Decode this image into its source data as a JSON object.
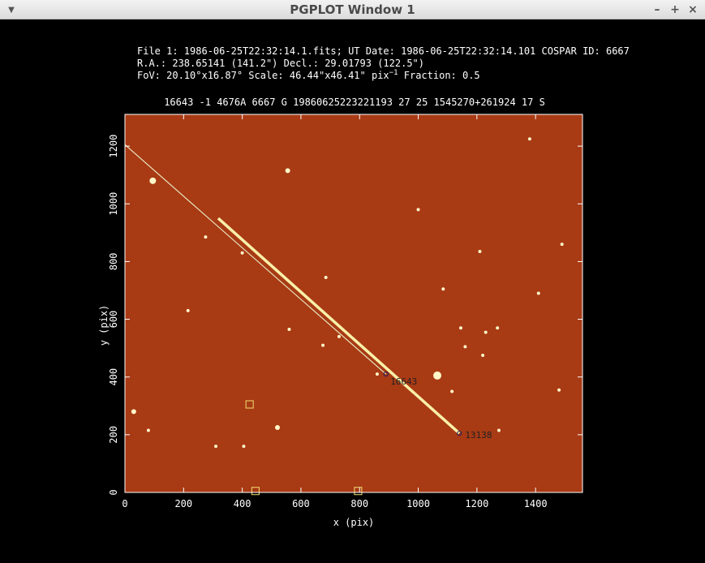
{
  "window": {
    "title": "PGPLOT Window 1",
    "menu_icon": "chevron-down-icon",
    "minimize_label": "–",
    "maximize_label": "+",
    "close_label": "×"
  },
  "header": {
    "line1": "File 1: 1986-06-25T22:32:14.1.fits; UT Date: 1986-06-25T22:32:14.101  COSPAR ID: 6667",
    "line2": "R.A.:  238.65141 (141.2\")  Decl.:   29.01793 (122.5\")",
    "line3_a": "FoV: 20.10°x16.87° Scale: 46.44\"x46.41\" pix",
    "line3_sup": "−1",
    "line3_b": " Fraction: 0.5",
    "line4": "16643 -1 4676A  6667 G 19860625223221193 27 25 1545270+261924 17 S"
  },
  "chart_data": {
    "type": "scatter",
    "xlabel": "x (pix)",
    "ylabel": "y (pix)",
    "xlim": [
      0,
      1560
    ],
    "ylim": [
      0,
      1310
    ],
    "x_ticks": [
      0,
      200,
      400,
      600,
      800,
      1000,
      1200,
      1400
    ],
    "y_ticks": [
      0,
      200,
      400,
      600,
      800,
      1000,
      1200
    ],
    "background_color": "#a83a14",
    "streaks": [
      {
        "label": "16643",
        "x1": 0,
        "y1": 1205,
        "x2": 890,
        "y2": 410,
        "color": "#e8e8c0"
      },
      {
        "label": "13138",
        "x1": 318,
        "y1": 950,
        "x2": 1140,
        "y2": 205,
        "color": "#f8f0a8"
      }
    ],
    "labels": [
      {
        "text": "16643",
        "x": 905,
        "y": 385
      },
      {
        "text": "13138",
        "x": 1160,
        "y": 200
      }
    ],
    "markers": [
      {
        "x": 425,
        "y": 305,
        "shape": "square"
      },
      {
        "x": 445,
        "y": 5,
        "shape": "square"
      },
      {
        "x": 795,
        "y": 5,
        "shape": "square"
      }
    ],
    "stars": [
      {
        "x": 95,
        "y": 1080,
        "r": 4
      },
      {
        "x": 555,
        "y": 1115,
        "r": 3
      },
      {
        "x": 275,
        "y": 885,
        "r": 2
      },
      {
        "x": 400,
        "y": 830,
        "r": 2
      },
      {
        "x": 1210,
        "y": 835,
        "r": 2
      },
      {
        "x": 1490,
        "y": 860,
        "r": 2
      },
      {
        "x": 685,
        "y": 745,
        "r": 2
      },
      {
        "x": 1000,
        "y": 980,
        "r": 2
      },
      {
        "x": 1410,
        "y": 690,
        "r": 2
      },
      {
        "x": 1085,
        "y": 705,
        "r": 2
      },
      {
        "x": 1270,
        "y": 570,
        "r": 2
      },
      {
        "x": 1230,
        "y": 555,
        "r": 2
      },
      {
        "x": 1220,
        "y": 475,
        "r": 2
      },
      {
        "x": 1145,
        "y": 570,
        "r": 2
      },
      {
        "x": 1065,
        "y": 405,
        "r": 5
      },
      {
        "x": 860,
        "y": 410,
        "r": 2
      },
      {
        "x": 675,
        "y": 510,
        "r": 2
      },
      {
        "x": 730,
        "y": 540,
        "r": 2
      },
      {
        "x": 30,
        "y": 280,
        "r": 3
      },
      {
        "x": 520,
        "y": 225,
        "r": 3
      },
      {
        "x": 310,
        "y": 160,
        "r": 2
      },
      {
        "x": 405,
        "y": 160,
        "r": 2
      },
      {
        "x": 80,
        "y": 215,
        "r": 2
      },
      {
        "x": 1275,
        "y": 215,
        "r": 2
      },
      {
        "x": 1115,
        "y": 350,
        "r": 2
      },
      {
        "x": 1480,
        "y": 355,
        "r": 2
      },
      {
        "x": 1160,
        "y": 505,
        "r": 2
      },
      {
        "x": 215,
        "y": 630,
        "r": 2
      },
      {
        "x": 560,
        "y": 565,
        "r": 2
      },
      {
        "x": 1380,
        "y": 1225,
        "r": 2
      }
    ]
  }
}
